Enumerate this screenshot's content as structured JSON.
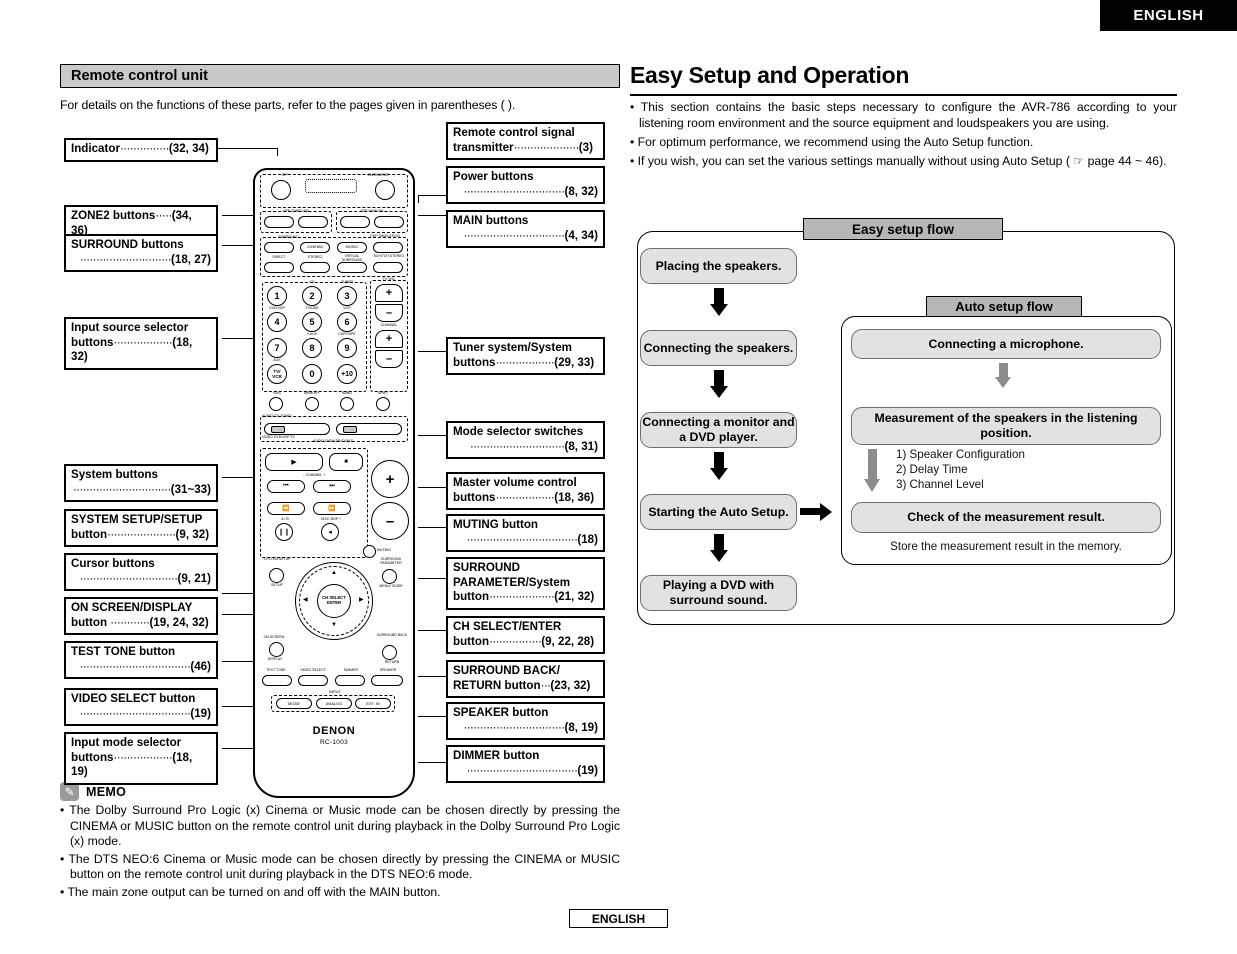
{
  "header": {
    "language_badge": "ENGLISH"
  },
  "footer": {
    "language_badge": "ENGLISH"
  },
  "left": {
    "section_title": "Remote control unit",
    "intro": "For details on the functions of these parts, refer to the pages given in parentheses (  ).",
    "callouts": [
      {
        "name": "indicator",
        "line1": "Indicator",
        "dots": "···············",
        "pages": "(32, 34)"
      },
      {
        "name": "zone2-buttons",
        "line1": "ZONE2 buttons",
        "dots": "·····",
        "pages": "(34, 36)"
      },
      {
        "name": "surround-buttons",
        "line1": "SURROUND buttons",
        "dots": "····························",
        "pages": "(18, 27)"
      },
      {
        "name": "input-source-selector",
        "line1": "Input source selector",
        "line2": "buttons",
        "dots": "··················",
        "pages": "(18, 32)"
      },
      {
        "name": "system-buttons",
        "line1": "System buttons",
        "dots": "······························",
        "pages": "(31~33)"
      },
      {
        "name": "system-setup-button",
        "line1": "SYSTEM SETUP/SETUP",
        "line2": "button",
        "dots": "·····················",
        "pages": "(9, 32)"
      },
      {
        "name": "cursor-buttons",
        "line1": "Cursor buttons",
        "dots": "······························",
        "pages": "(9, 21)"
      },
      {
        "name": "on-screen-display-button",
        "line1": "ON SCREEN/DISPLAY",
        "line2": "button",
        "dots": "············",
        "pages": "(19, 24, 32)"
      },
      {
        "name": "test-tone-button",
        "line1": "TEST TONE button",
        "dots": "··································",
        "pages": "(46)"
      },
      {
        "name": "video-select-button",
        "line1": "VIDEO SELECT button",
        "dots": "··································",
        "pages": "(19)"
      },
      {
        "name": "input-mode-selector",
        "line1": "Input mode selector",
        "line2": "buttons",
        "dots": "··················",
        "pages": "(18, 19)"
      },
      {
        "name": "remote-signal-transmitter",
        "line1": "Remote control signal",
        "line2": "transmitter",
        "dots": "····················",
        "pages": "(3)"
      },
      {
        "name": "power-buttons",
        "line1": "Power buttons",
        "dots": "·······························",
        "pages": "(8, 32)"
      },
      {
        "name": "main-buttons",
        "line1": "MAIN buttons",
        "dots": "·······························",
        "pages": "(4, 34)"
      },
      {
        "name": "tuner-system-buttons",
        "line1": "Tuner system/System",
        "line2": "buttons",
        "dots": "··················",
        "pages": "(29, 33)"
      },
      {
        "name": "mode-selector-switches",
        "line1": "Mode selector switches",
        "dots": "·····························",
        "pages": "(8, 31)"
      },
      {
        "name": "master-volume-buttons",
        "line1": "Master volume control",
        "line2": "buttons",
        "dots": "··················",
        "pages": "(18, 36)"
      },
      {
        "name": "muting-button",
        "line1": "MUTING button",
        "dots": "··································",
        "pages": "(18)"
      },
      {
        "name": "surround-parameter-button",
        "line1": "SURROUND",
        "line2": "PARAMETER/System",
        "line3": "button",
        "dots": "····················",
        "pages": "(21, 32)"
      },
      {
        "name": "ch-select-enter-button",
        "line1": "CH SELECT/ENTER",
        "line2": "button",
        "dots": "················",
        "pages": "(9, 22, 28)"
      },
      {
        "name": "surround-back-return-button",
        "line1": "SURROUND BACK/",
        "line2": "RETURN button",
        "dots": "···",
        "pages": "(23, 32)"
      },
      {
        "name": "speaker-button",
        "line1": "SPEAKER button",
        "dots": "·······························",
        "pages": "(8, 19)"
      },
      {
        "name": "dimmer-button",
        "line1": "DIMMER button",
        "dots": "··································",
        "pages": "(19)"
      }
    ],
    "memo": {
      "title": "MEMO",
      "icon": "pencil-icon",
      "items": [
        "The Dolby Surround Pro Logic   (x) Cinema or Music mode can be chosen directly by pressing the CINEMA or MUSIC button on the remote control unit during playback in the Dolby Surround Pro Logic   (x) mode.",
        "The DTS NEO:6 Cinema or Music mode can be chosen directly by pressing the CINEMA or MUSIC button on the remote control unit during playback in the DTS NEO:6 mode.",
        "The main zone output can be turned on and off with the MAIN button."
      ]
    }
  },
  "remote": {
    "brand": "DENON",
    "model": "RC-1003",
    "top_labels": {
      "off": "OFF",
      "on_source": "ON/SOURCE"
    },
    "zone_labels": {
      "left": "OFF  ZONE2  ON",
      "right": "OFF  MAIN  ON"
    },
    "surround_group_label": "SURROUND",
    "dsp_label": "DSP SIMULATION",
    "surround_row1": [
      "",
      "CINEMA",
      "MUSIC",
      ""
    ],
    "surround_row2": [
      "DIRECT",
      "STEREO",
      "VIRTUAL SURROUND",
      "5CH/7CH STEREO"
    ],
    "keypad": [
      {
        "key": "1",
        "sub": "CD"
      },
      {
        "key": "2",
        "sub": "TUNER"
      },
      {
        "key": "3",
        "sub": ""
      },
      {
        "key": "4",
        "sub": "DVD/VDP"
      },
      {
        "key": "5",
        "sub": "TV/DBS"
      },
      {
        "key": "6",
        "sub": "VCR"
      },
      {
        "key": "7",
        "sub": "V.AUX"
      },
      {
        "key": "8",
        "sub": "CDR/TAPE"
      },
      {
        "key": "9",
        "sub": ""
      },
      {
        "key": "TV/ VCR",
        "sub": "AUX"
      },
      {
        "key": "0",
        "sub": ""
      },
      {
        "key": "+10",
        "sub": ""
      }
    ],
    "tv_vol_label": "TV VOL",
    "channel_label": "CHANNEL",
    "row_after_keypad": [
      "RDS",
      "MEMORY",
      "BAND",
      "SHIFT"
    ],
    "mode_switch_labels": {
      "top": "AUDIO         CD         ZONE2",
      "bottom": "VIDEO   DVD/VDP        TV"
    },
    "mode_switch_sub": "AUDIO   DVD/VDP/CABLE",
    "transport": {
      "play": "▶",
      "stop": "■"
    },
    "channel_skip_label": "–  CHANNEL  +",
    "transport_row2": [
      "⏮",
      "⏭"
    ],
    "transport_row3": [
      "⏪",
      "⏩"
    ],
    "transport_row4_labels": [
      "A / B",
      "DISC SKIP +"
    ],
    "volume": {
      "plus": "+",
      "minus": "–"
    },
    "muting_label": "MUTING",
    "system_setup_label": "SYSTEM SETUP",
    "setup_label": "SETUP",
    "surround_param_label": "SURROUND PARAMETER",
    "menu_guide_label": "MENU/ GUIDE",
    "cursor_center": "CH SELECT ENTER",
    "on_screen_label": "ON SCREEN",
    "display_label": "DISPLAY",
    "surround_back_label": "SURROUND BACK",
    "return_label": "RETURN",
    "bottom_row": [
      "TEST TONE",
      "VIDEO SELECT",
      "DIMMER",
      "SPEAKER"
    ],
    "input_group_label": "INPUT",
    "input_row": [
      "MODE",
      "ANALOG",
      "EXT. IN"
    ]
  },
  "right": {
    "title": "Easy Setup and Operation",
    "bullets": [
      "This section contains the basic steps necessary to configure the AVR-786 according to your listening room environment and the source equipment and loudspeakers you are using.",
      "For optimum performance, we recommend using the Auto Setup function.",
      "If you wish, you can set the various settings manually without using Auto Setup ( ☞ page 44 ~ 46)."
    ],
    "easy_flow": {
      "title": "Easy setup flow",
      "steps": [
        "Placing the speakers.",
        "Connecting the speakers.",
        "Connecting a monitor and a DVD player.",
        "Starting the Auto Setup.",
        "Playing a DVD with surround sound."
      ]
    },
    "auto_flow": {
      "title": "Auto setup flow",
      "step1": "Connecting a microphone.",
      "step2": "Measurement of the speakers in the listening position.",
      "substeps": [
        "1)  Speaker Configuration",
        "2)  Delay Time",
        "3)  Channel Level"
      ],
      "step3": "Check of the measurement result.",
      "note": "Store the measurement result in the memory."
    }
  },
  "colors": {
    "bar_gray": "#c9c9c9",
    "flow_title_gray": "#b7b7b7",
    "flow_box_gray": "#e2e2e2",
    "arrow_gray": "#8c8c8c",
    "black": "#000000"
  }
}
